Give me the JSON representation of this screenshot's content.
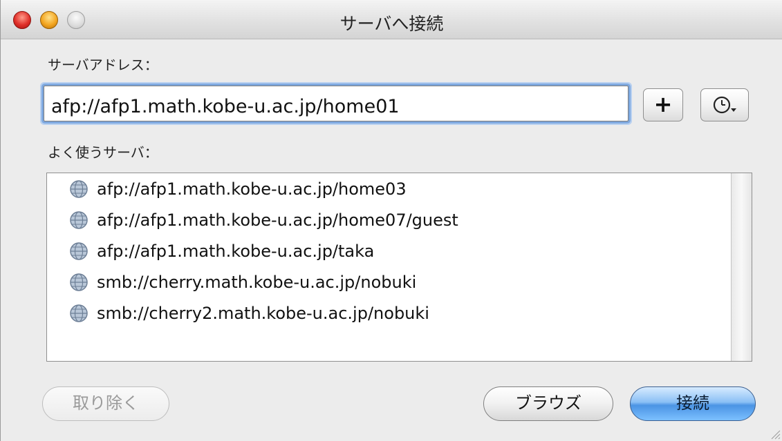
{
  "window": {
    "title": "サーバへ接続"
  },
  "address": {
    "label": "サーバアドレス：",
    "value": "afp://afp1.math.kobe-u.ac.jp/home01",
    "add_label": "+",
    "recent_icon": "clock-dropdown-icon"
  },
  "favorites": {
    "label": "よく使うサーバ：",
    "items": [
      {
        "text": "afp://afp1.math.kobe-u.ac.jp/home03",
        "icon": "network-globe-icon"
      },
      {
        "text": "afp://afp1.math.kobe-u.ac.jp/home07/guest",
        "icon": "network-globe-icon"
      },
      {
        "text": "afp://afp1.math.kobe-u.ac.jp/taka",
        "icon": "network-globe-icon"
      },
      {
        "text": "smb://cherry.math.kobe-u.ac.jp/nobuki",
        "icon": "network-globe-icon"
      },
      {
        "text": "smb://cherry2.math.kobe-u.ac.jp/nobuki",
        "icon": "network-globe-icon"
      }
    ]
  },
  "buttons": {
    "remove": "取り除く",
    "browse": "ブラウズ",
    "connect": "接続"
  }
}
